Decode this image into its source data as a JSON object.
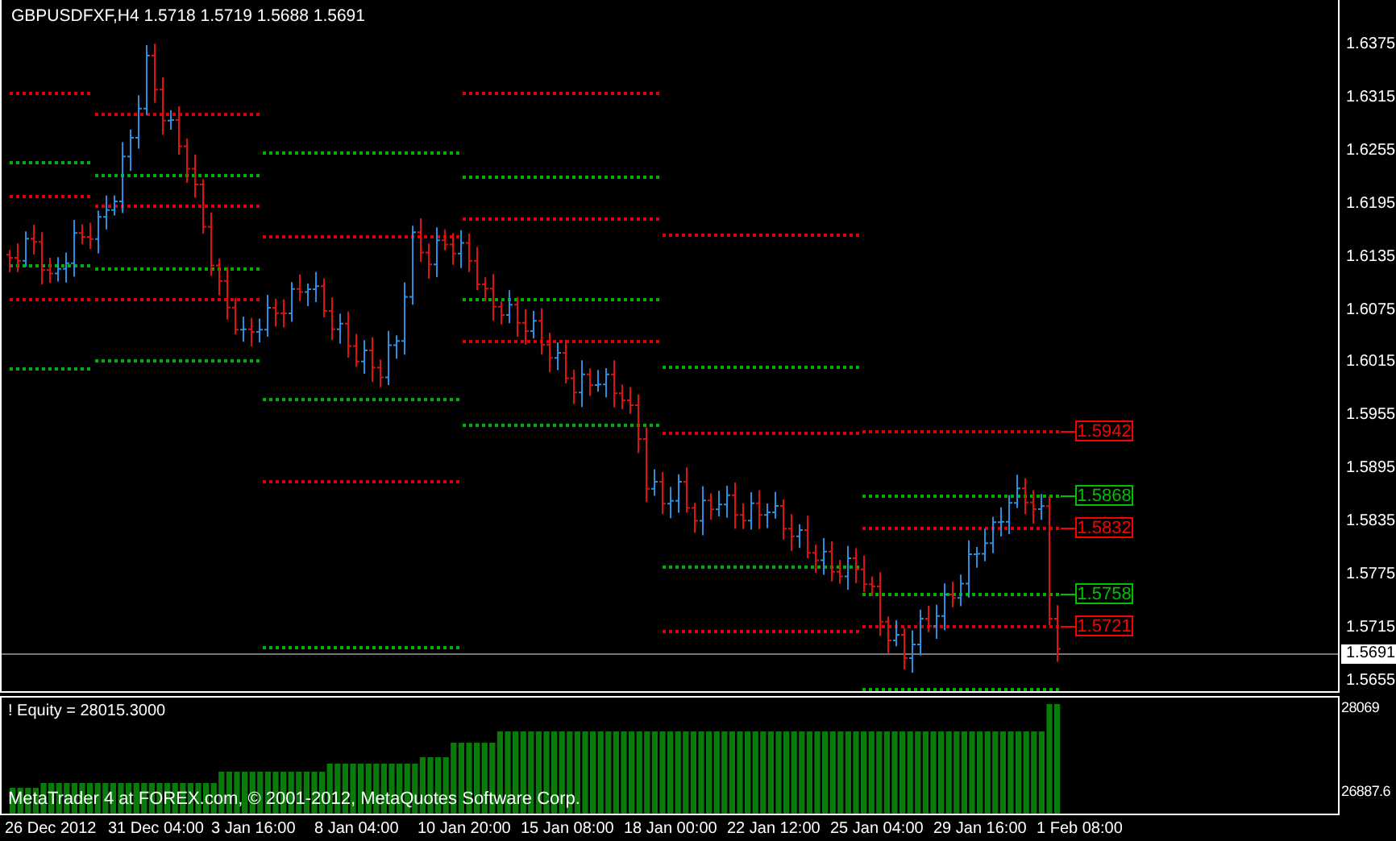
{
  "chart": {
    "title": "GBPUSDFXF,H4  1.5718 1.5719 1.5688 1.5691",
    "price_axis": [
      "1.6375",
      "1.6315",
      "1.6255",
      "1.6195",
      "1.6135",
      "1.6075",
      "1.6015",
      "1.5955",
      "1.5895",
      "1.5835",
      "1.5775",
      "1.5715",
      "1.5655"
    ],
    "current_price": "1.5691",
    "level_tags": [
      {
        "label": "1.5942",
        "color": "#ff0000"
      },
      {
        "label": "1.5868",
        "color": "#00c000"
      },
      {
        "label": "1.5832",
        "color": "#ff0000"
      },
      {
        "label": "1.5758",
        "color": "#00c000"
      },
      {
        "label": "1.5721",
        "color": "#ff0000"
      }
    ]
  },
  "indicator": {
    "label": "! Equity = 28015.3000",
    "axis": [
      "28069",
      "26887.6"
    ],
    "copyright": "MetaTrader 4 at FOREX.com, © 2001-2012, MetaQuotes Software Corp."
  },
  "time_axis": [
    "26 Dec 2012",
    "31 Dec 04:00",
    "3 Jan 16:00",
    "8 Jan 04:00",
    "10 Jan 20:00",
    "15 Jan 08:00",
    "18 Jan 00:00",
    "22 Jan 12:00",
    "25 Jan 04:00",
    "29 Jan 16:00",
    "1 Feb 08:00"
  ]
}
